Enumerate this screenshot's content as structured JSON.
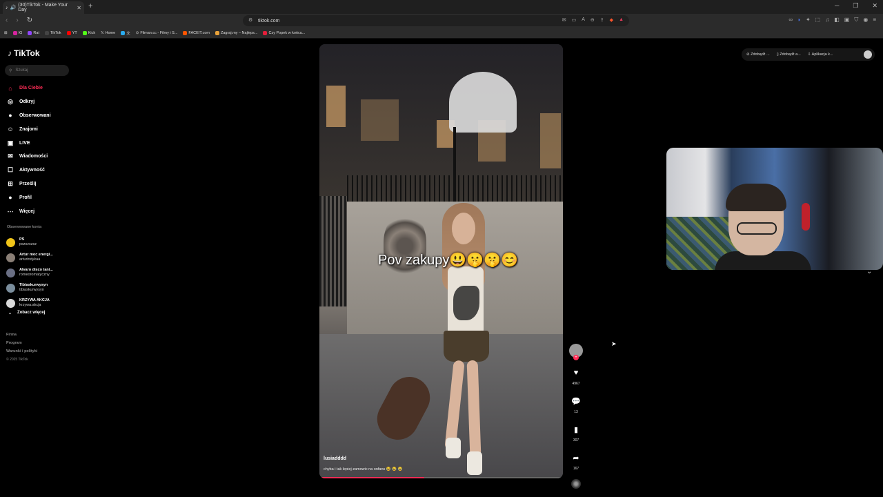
{
  "browser": {
    "tab_title": "(30)TikTok - Make Your Day",
    "url": "tiktok.com",
    "bookmarks": [
      {
        "label": "IG",
        "color": "#d6249f"
      },
      {
        "label": "Rat",
        "color": "#9146ff"
      },
      {
        "label": "TikTok",
        "color": "#111111"
      },
      {
        "label": "YT",
        "color": "#ff0000"
      },
      {
        "label": "Kick",
        "color": "#53fc18"
      },
      {
        "label": "Home",
        "color": "#000000"
      },
      {
        "label": "",
        "color": "#2aabee"
      },
      {
        "label": "Filman.cc - Filmy i S...",
        "color": "#3a3a3a"
      },
      {
        "label": "FACEIT.com",
        "color": "#ff5500"
      },
      {
        "label": "Zagraj.my – Najleps...",
        "color": "#e8a23a"
      },
      {
        "label": "Czy Popek w końcu...",
        "color": "#e51e3a"
      }
    ]
  },
  "sidebar": {
    "logo": "TikTok",
    "search_placeholder": "Szukaj",
    "menu": [
      {
        "label": "Dla Ciebie",
        "icon": "home-icon",
        "glyph": "⌂",
        "active": true
      },
      {
        "label": "Odkryj",
        "icon": "compass-icon",
        "glyph": "◎",
        "active": false
      },
      {
        "label": "Obserwowani",
        "icon": "following-avatar-icon",
        "glyph": "●",
        "active": false
      },
      {
        "label": "Znajomi",
        "icon": "friends-icon",
        "glyph": "☺",
        "active": false
      },
      {
        "label": "LIVE",
        "icon": "live-icon",
        "glyph": "▣",
        "active": false
      },
      {
        "label": "Wiadomości",
        "icon": "messages-icon",
        "glyph": "✉",
        "active": false
      },
      {
        "label": "Aktywność",
        "icon": "activity-icon",
        "glyph": "☐",
        "active": false
      },
      {
        "label": "Prześlij",
        "icon": "upload-icon",
        "glyph": "⊞",
        "active": false
      },
      {
        "label": "Profil",
        "icon": "profile-icon",
        "glyph": "●",
        "active": false
      },
      {
        "label": "Więcej",
        "icon": "more-icon",
        "glyph": "⋯",
        "active": false
      }
    ],
    "following_title": "Obserwowane konta",
    "following": [
      {
        "name": "PS",
        "handle": "pszszszsz",
        "color": "#f0c419"
      },
      {
        "name": "Artur moc energi...",
        "handle": "arturindykaa",
        "color": "#8a7f76"
      },
      {
        "name": "Alvaro disco tani...",
        "handle": "romeoromatyczny",
        "color": "#6a6f84"
      },
      {
        "name": "Tibiaskurwysyn",
        "handle": "tibiaskurwysyn",
        "color": "#7a8d9c"
      },
      {
        "name": "KRZYWA AKCJA",
        "handle": "krzywa.akcja",
        "color": "#d8d8d8"
      }
    ],
    "see_more": "Zobacz więcej",
    "footer": [
      "Firma",
      "Program",
      "Warunki i polityki"
    ],
    "copyright": "© 2025 TikTok"
  },
  "video": {
    "overlay_text": "Pov zakupy😃🤫🤫😊",
    "author": "lusiadddd",
    "description": "chyba i tak lepiej zamowic na onfans 😂 😂 😂",
    "progress": 0.43
  },
  "actions": {
    "likes": "4967",
    "comments": "13",
    "saves": "307",
    "shares": "167"
  },
  "top_right": {
    "item1": "Zdobądź ...",
    "item2": "Zdobądź a...",
    "item3": "Aplikacja k..."
  }
}
